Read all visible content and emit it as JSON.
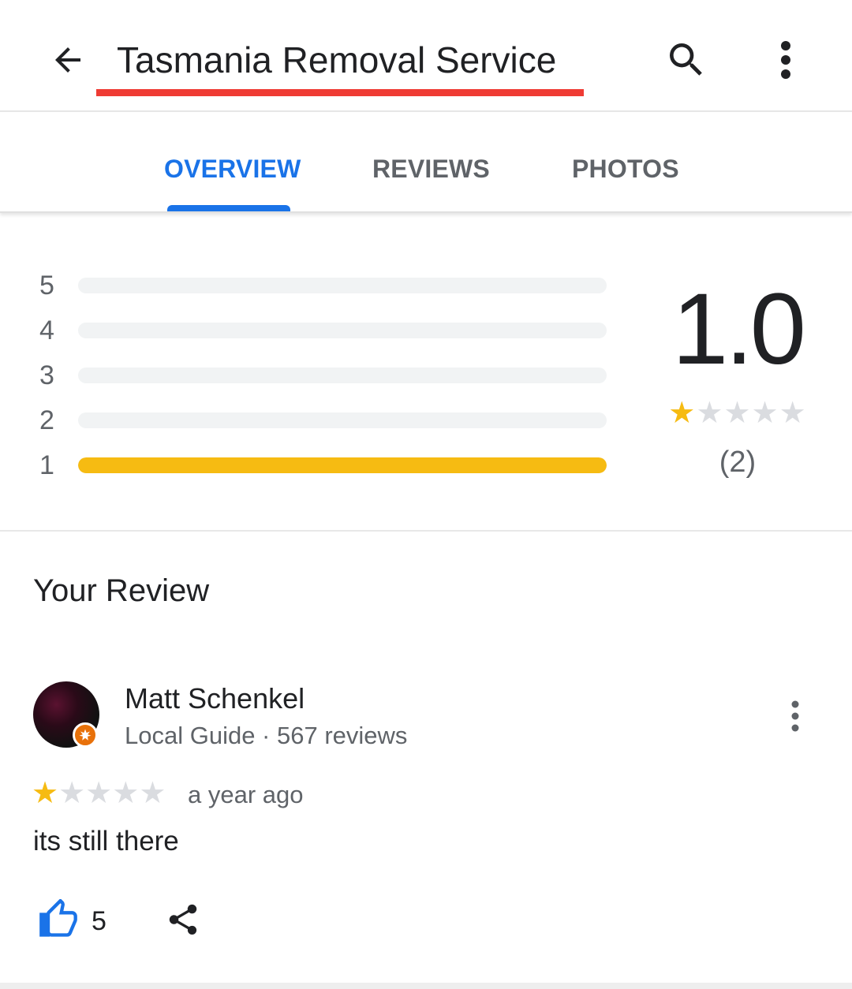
{
  "header": {
    "title": "Tasmania Removal Service",
    "back_icon": "arrow-left-icon",
    "search_icon": "search-icon",
    "more_icon": "more-vert-icon",
    "highlight_color": "#ef3b34"
  },
  "tabs": [
    {
      "label": "OVERVIEW",
      "active": true
    },
    {
      "label": "REVIEWS",
      "active": false
    },
    {
      "label": "PHOTOS",
      "active": false
    }
  ],
  "rating_summary": {
    "distribution": [
      {
        "stars": "5",
        "fraction": 0
      },
      {
        "stars": "4",
        "fraction": 0
      },
      {
        "stars": "3",
        "fraction": 0
      },
      {
        "stars": "2",
        "fraction": 0
      },
      {
        "stars": "1",
        "fraction": 1
      }
    ],
    "average": "1.0",
    "stars_filled": 1,
    "stars_total": 5,
    "count": "(2)",
    "bar_color": "#f6bb12"
  },
  "your_review": {
    "section_title": "Your Review",
    "reviewer": {
      "name": "Matt Schenkel",
      "meta": "Local Guide · 567 reviews"
    },
    "rating": 1,
    "time": "a year ago",
    "text": "its still there",
    "likes": "5",
    "like_icon": "thumbs-up-icon",
    "share_icon": "share-icon"
  },
  "colors": {
    "accent": "#1a73e8",
    "star": "#f6bb12"
  }
}
